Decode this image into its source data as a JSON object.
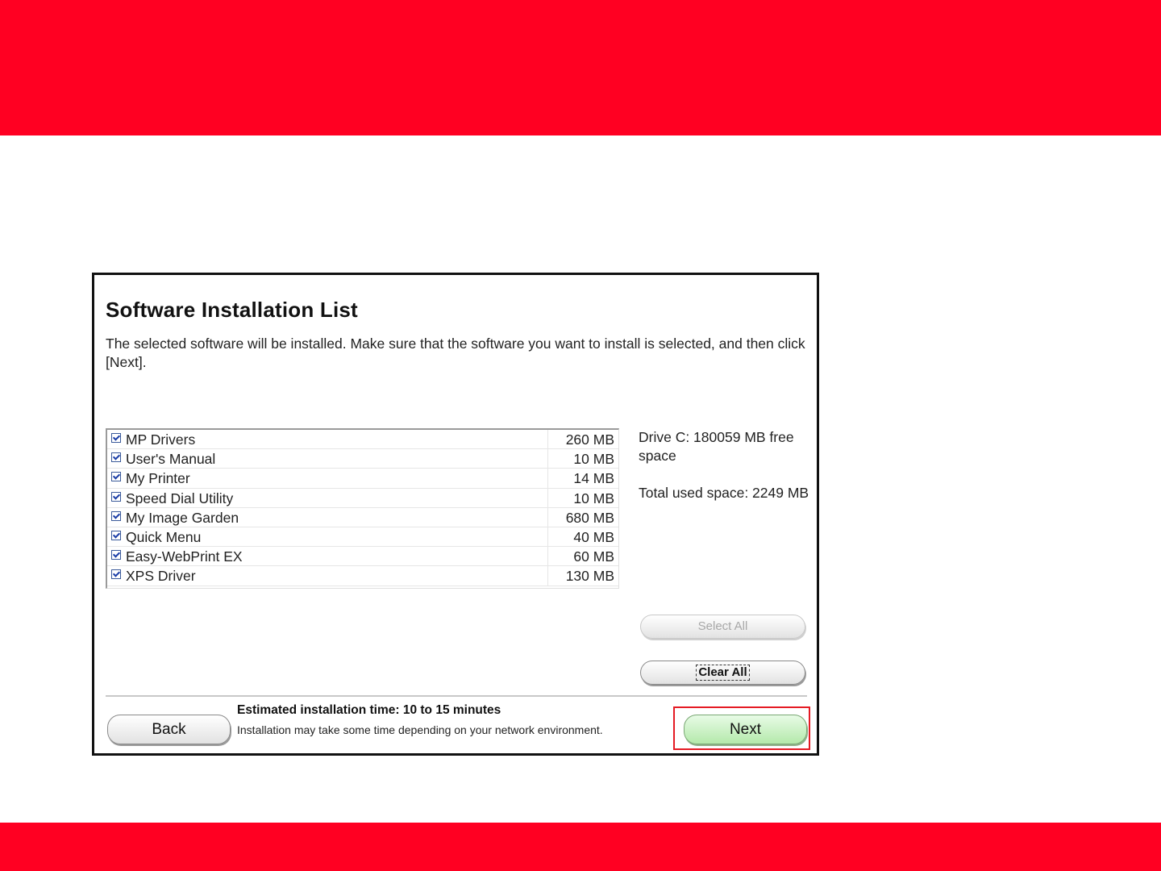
{
  "colors": {
    "band": "#ff0022",
    "next_button_fill": "#c8f1c1",
    "highlight_frame": "#e51b24"
  },
  "dialog": {
    "title": "Software Installation List",
    "description": "The selected software will be installed. Make sure that the software you want to install is selected, and then click [Next]."
  },
  "software_list": {
    "items": [
      {
        "name": "MP Drivers",
        "size": "260 MB",
        "checked": true
      },
      {
        "name": "User's Manual",
        "size": "10 MB",
        "checked": true
      },
      {
        "name": "My Printer",
        "size": "14 MB",
        "checked": true
      },
      {
        "name": "Speed Dial Utility",
        "size": "10 MB",
        "checked": true
      },
      {
        "name": "My Image Garden",
        "size": "680 MB",
        "checked": true
      },
      {
        "name": "Quick Menu",
        "size": "40 MB",
        "checked": true
      },
      {
        "name": "Easy-WebPrint EX",
        "size": "60 MB",
        "checked": true
      },
      {
        "name": "XPS Driver",
        "size": "130 MB",
        "checked": true
      }
    ]
  },
  "side_info": {
    "drive_space": "Drive C: 180059 MB free space",
    "total_used": "Total used space: 2249 MB"
  },
  "buttons": {
    "select_all": "Select All",
    "clear_all": "Clear All",
    "back": "Back",
    "next": "Next"
  },
  "footer": {
    "estimate_title": "Estimated installation time: 10 to 15 minutes",
    "estimate_note": "Installation may take some time depending on your network environment."
  }
}
